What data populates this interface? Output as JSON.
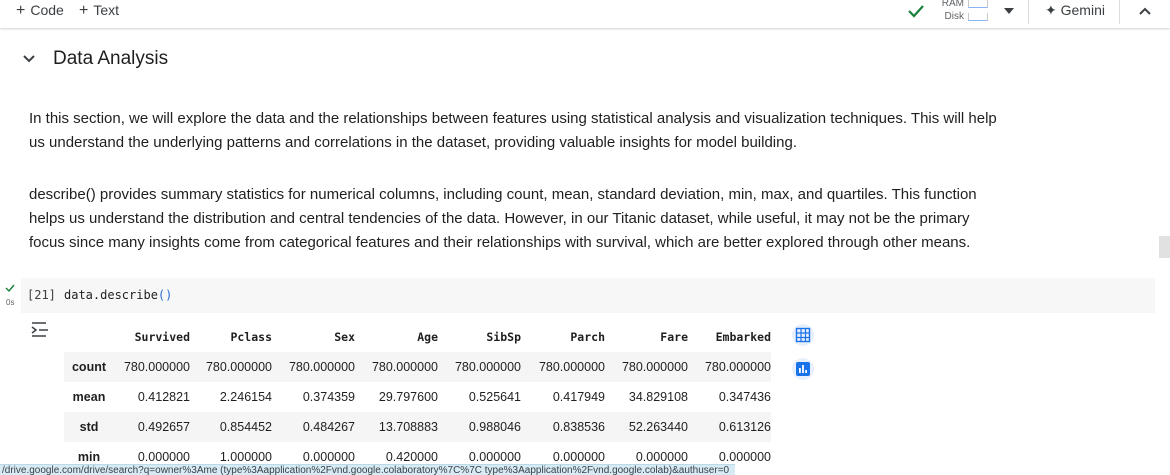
{
  "toolbar": {
    "add_code": "Code",
    "add_text": "Text",
    "ram_label": "RAM",
    "disk_label": "Disk",
    "gemini_label": "Gemini"
  },
  "section": {
    "title": "Data Analysis",
    "para1": "In this section, we will explore the data and the relationships between features using statistical analysis and visualization techniques. This will help us understand the underlying patterns and correlations in the dataset, providing valuable insights for model building.",
    "para2": "describe() provides summary statistics for numerical columns, including count, mean, standard deviation, min, max, and quartiles. This function helps us understand the distribution and central tendencies of the data. However, in our Titanic dataset, while useful, it may not be the primary focus since many insights come from categorical features and their relationships with survival, which are better explored through other means."
  },
  "cell": {
    "exec_count": "[21]",
    "exec_time": "0s",
    "code_prefix": "data.describe",
    "code_parens": "()"
  },
  "table": {
    "columns": [
      "Survived",
      "Pclass",
      "Sex",
      "Age",
      "SibSp",
      "Parch",
      "Fare",
      "Embarked"
    ],
    "rows": [
      {
        "label": "count",
        "values": [
          "780.000000",
          "780.000000",
          "780.000000",
          "780.000000",
          "780.000000",
          "780.000000",
          "780.000000",
          "780.000000"
        ]
      },
      {
        "label": "mean",
        "values": [
          "0.412821",
          "2.246154",
          "0.374359",
          "29.797600",
          "0.525641",
          "0.417949",
          "34.829108",
          "0.347436"
        ]
      },
      {
        "label": "std",
        "values": [
          "0.492657",
          "0.854452",
          "0.484267",
          "13.708883",
          "0.988046",
          "0.838536",
          "52.263440",
          "0.613126"
        ]
      },
      {
        "label": "min",
        "values": [
          "0.000000",
          "1.000000",
          "0.000000",
          "0.420000",
          "0.000000",
          "0.000000",
          "0.000000",
          "0.000000"
        ]
      }
    ]
  },
  "status_url": "/drive.google.com/drive/search?q=owner%3Ame (type%3Aapplication%2Fvnd.google.colaboratory%7C%7C type%3Aapplication%2Fvnd.google.colab)&authuser=0",
  "colors": {
    "accent": "#1a73e8",
    "check": "#188038",
    "button_bg": "#e8f0fe"
  }
}
